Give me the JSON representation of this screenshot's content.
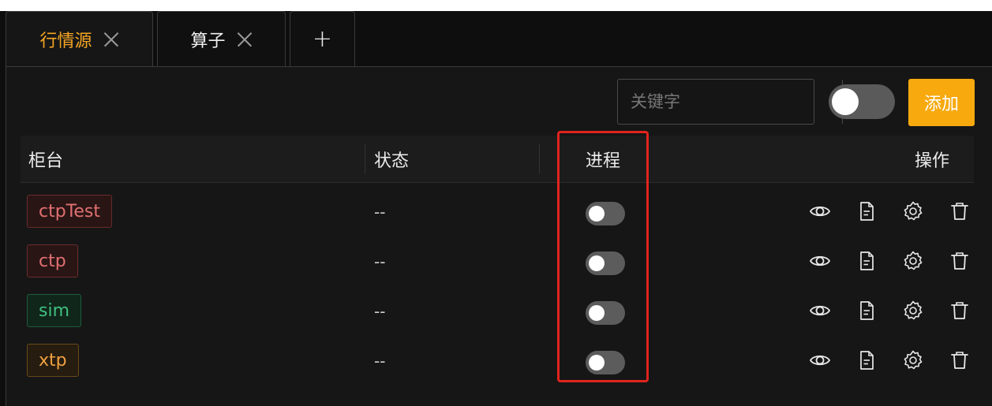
{
  "tabs": [
    {
      "label": "行情源",
      "active": true
    },
    {
      "label": "算子",
      "active": false
    }
  ],
  "add_tab_label": "+",
  "toolbar": {
    "search_placeholder": "关键字",
    "add_button_label": "添加"
  },
  "table": {
    "headers": {
      "counter": "柜台",
      "status": "状态",
      "process": "进程",
      "actions": "操作"
    },
    "rows": [
      {
        "name": "ctpTest",
        "status": "--",
        "color": "#e07070",
        "border": "#6a2b2b",
        "bg": "#2a1515"
      },
      {
        "name": "ctp",
        "status": "--",
        "color": "#e07070",
        "border": "#6a2b2b",
        "bg": "#2a1515"
      },
      {
        "name": "sim",
        "status": "--",
        "color": "#3fbf7f",
        "border": "#1f5c3f",
        "bg": "#11261b"
      },
      {
        "name": "xtp",
        "status": "--",
        "color": "#f0a040",
        "border": "#6a4a1a",
        "bg": "#261c0f"
      }
    ]
  },
  "colors": {
    "accent": "#f5a623",
    "add_button": "#f7a90e",
    "highlight": "#e0241d"
  },
  "icons": {
    "tab_close": "close-icon",
    "search": "search-icon",
    "view": "eye-icon",
    "log": "document-icon",
    "settings": "gear-icon",
    "delete": "trash-icon"
  }
}
